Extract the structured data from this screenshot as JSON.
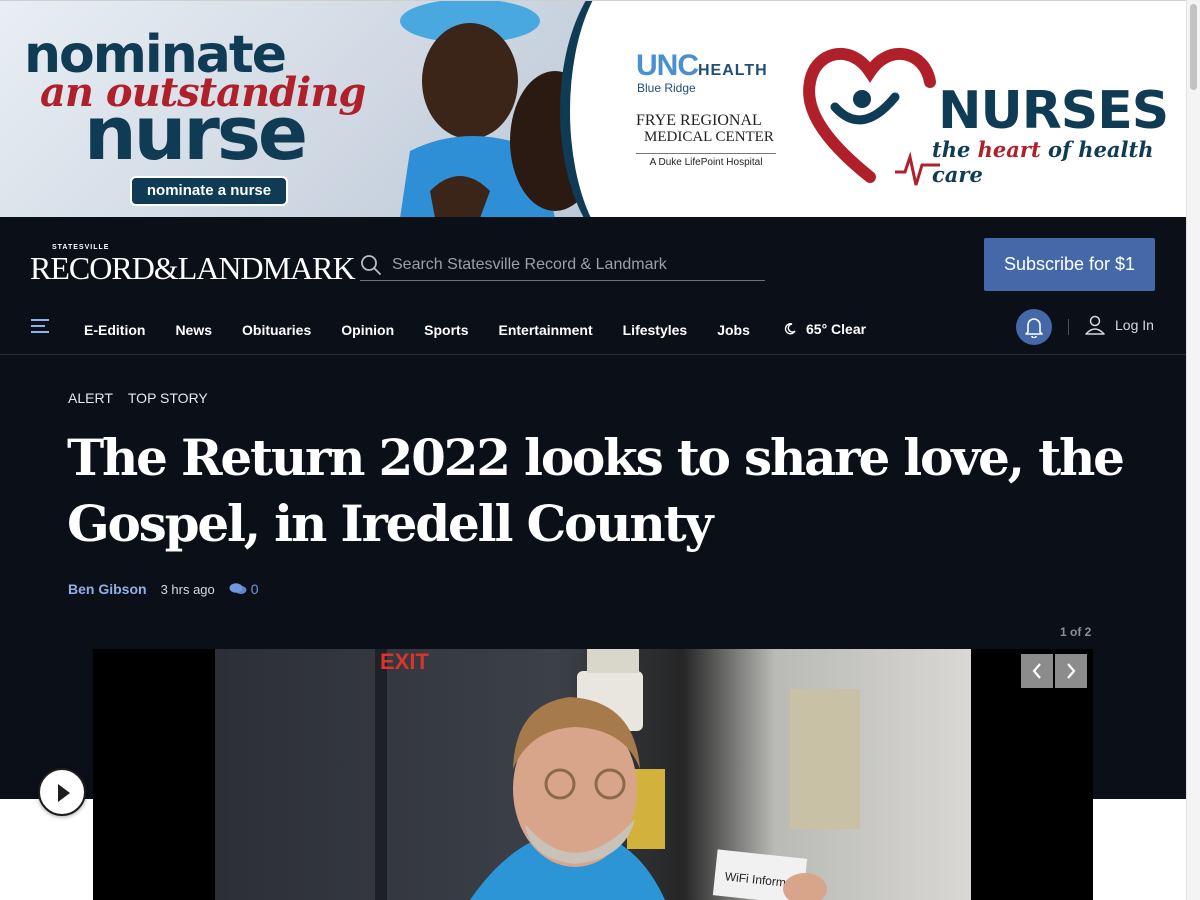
{
  "ad": {
    "headline_1": "nominate",
    "headline_2": "an outstanding",
    "headline_3": "nurse",
    "button_label": "nominate a nurse",
    "unc_logo": "UNC",
    "unc_health": "HEALTH",
    "blue_ridge": "Blue Ridge",
    "frye_line1": "FRYE REGIONAL",
    "frye_line2": "MEDICAL CENTER",
    "duke_line": "A Duke LifePoint Hospital",
    "nurses_title": "NURSES",
    "tagline_pre": "the ",
    "tagline_highlight": "heart",
    "tagline_post": " of health care"
  },
  "site": {
    "logo_small": "STATESVILLE",
    "logo_main": "RECORD&LANDMARK",
    "search_placeholder": "Search Statesville Record & Landmark",
    "subscribe_label": "Subscribe for $1"
  },
  "nav": {
    "items": [
      "E-Edition",
      "News",
      "Obituaries",
      "Opinion",
      "Sports",
      "Entertainment",
      "Lifestyles",
      "Jobs"
    ],
    "weather": "65° Clear",
    "login_label": "Log In"
  },
  "article": {
    "tags": [
      "ALERT",
      "TOP STORY"
    ],
    "headline": "The Return 2022 looks to share love, the Gospel, in Iredell County",
    "author": "Ben Gibson",
    "time": "3 hrs ago",
    "comment_count": "0",
    "gallery_counter": "1 of 2",
    "photo_sign_text": "WiFi Information",
    "photo_exit_text": "EXIT"
  },
  "colors": {
    "header_bg": "#0b0f17",
    "accent": "#4568a8",
    "author_link": "#8fb0e8",
    "ad_navy": "#0f3b55",
    "ad_red": "#b0202b"
  },
  "icons": [
    "search-icon",
    "hamburger-icon",
    "moon-icon",
    "bell-icon",
    "user-icon",
    "comment-icon",
    "chevron-left-icon",
    "chevron-right-icon",
    "play-icon",
    "heart-logo-icon"
  ]
}
